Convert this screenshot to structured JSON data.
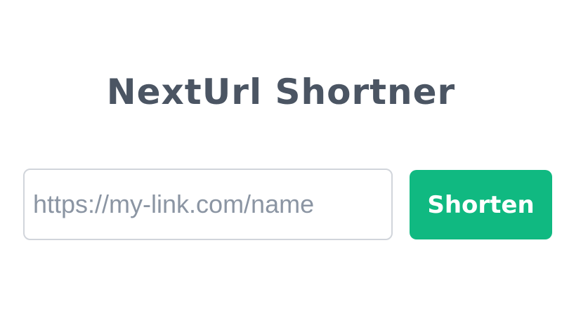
{
  "app": {
    "title": "NextUrl Shortner"
  },
  "form": {
    "url_input": {
      "value": "",
      "placeholder": "https://my-link.com/name"
    },
    "shorten_button": {
      "label": "Shorten"
    }
  },
  "colors": {
    "title_text": "#4b5563",
    "button_bg": "#10b981",
    "button_text": "#ffffff",
    "input_border": "#d1d5db",
    "placeholder_text": "#8b95a3"
  }
}
